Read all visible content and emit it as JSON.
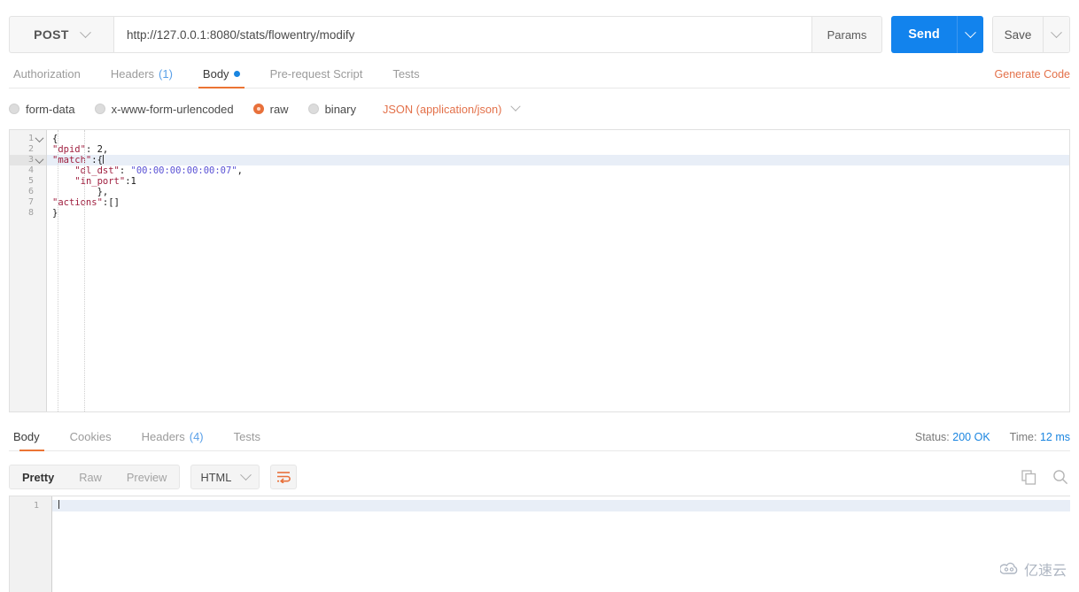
{
  "request": {
    "method": "POST",
    "url": "http://127.0.0.1:8080/stats/flowentry/modify",
    "params_label": "Params",
    "send_label": "Send",
    "save_label": "Save",
    "tabs": [
      {
        "label": "Authorization",
        "count": "",
        "active": false,
        "dot": false
      },
      {
        "label": "Headers",
        "count": "(1)",
        "active": false,
        "dot": false
      },
      {
        "label": "Body",
        "count": "",
        "active": true,
        "dot": true
      },
      {
        "label": "Pre-request Script",
        "count": "",
        "active": false,
        "dot": false
      },
      {
        "label": "Tests",
        "count": "",
        "active": false,
        "dot": false
      }
    ],
    "generate_code_label": "Generate Code",
    "body_types": [
      {
        "label": "form-data",
        "selected": false
      },
      {
        "label": "x-www-form-urlencoded",
        "selected": false
      },
      {
        "label": "raw",
        "selected": true
      },
      {
        "label": "binary",
        "selected": false
      }
    ],
    "mime_type": "JSON (application/json)",
    "editor": {
      "lines": [
        {
          "no": "1",
          "fold": true,
          "highlight": false,
          "text": "{"
        },
        {
          "no": "2",
          "fold": false,
          "highlight": false,
          "text": "\"dpid\": 2,"
        },
        {
          "no": "3",
          "fold": true,
          "highlight": true,
          "text": "\"match\":{"
        },
        {
          "no": "4",
          "fold": false,
          "highlight": false,
          "text": "    \"dl_dst\": \"00:00:00:00:00:07\","
        },
        {
          "no": "5",
          "fold": false,
          "highlight": false,
          "text": "    \"in_port\":1"
        },
        {
          "no": "6",
          "fold": false,
          "highlight": false,
          "text": "        },"
        },
        {
          "no": "7",
          "fold": false,
          "highlight": false,
          "text": "\"actions\":[]"
        },
        {
          "no": "8",
          "fold": false,
          "highlight": false,
          "text": "}"
        }
      ],
      "raw_body": "{\n\"dpid\": 2,\n\"match\":{\n    \"dl_dst\": \"00:00:00:00:00:07\",\n    \"in_port\":1\n        },\n\"actions\":[]\n}"
    }
  },
  "response": {
    "tabs": [
      {
        "label": "Body",
        "count": "",
        "active": true
      },
      {
        "label": "Cookies",
        "count": "",
        "active": false
      },
      {
        "label": "Headers",
        "count": "(4)",
        "active": false
      },
      {
        "label": "Tests",
        "count": "",
        "active": false
      }
    ],
    "status_label": "Status:",
    "status_value": "200 OK",
    "time_label": "Time:",
    "time_value": "12 ms",
    "view_modes": [
      {
        "label": "Pretty",
        "active": true
      },
      {
        "label": "Raw",
        "active": false
      },
      {
        "label": "Preview",
        "active": false
      }
    ],
    "format": "HTML",
    "wrap_icon": "word-wrap-icon",
    "copy_icon": "copy-icon",
    "search_icon": "search-icon",
    "body_lines": [
      {
        "no": "1",
        "text": ""
      }
    ]
  },
  "watermark": {
    "text": "亿速云"
  },
  "colors": {
    "accent_orange": "#eb7434",
    "primary_blue": "#1283ed",
    "link_blue": "#1a85e0",
    "json_key": "#a02040",
    "json_string": "#5a52d5"
  }
}
